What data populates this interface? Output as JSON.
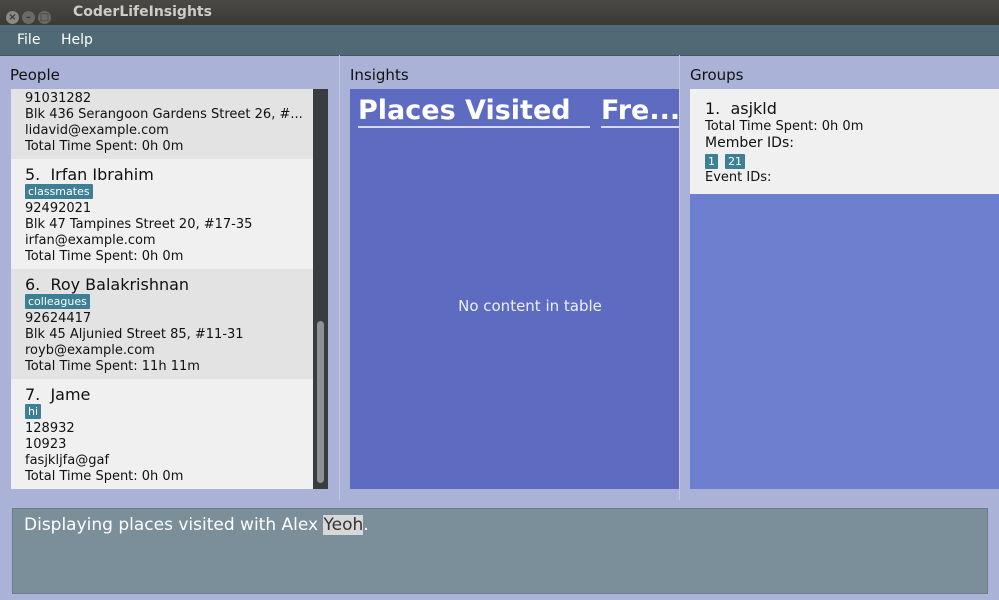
{
  "window": {
    "title": "CoderLifeInsights"
  },
  "menu": {
    "items": [
      "File",
      "Help"
    ]
  },
  "people": {
    "title": "People",
    "persons": [
      {
        "phone": "91031282",
        "address": "Blk 436 Serangoon Gardens Street 26, #...",
        "email": "lidavid@example.com",
        "time": "Total Time Spent: 0h 0m"
      },
      {
        "index": "5.",
        "name": "Irfan Ibrahim",
        "tag": "classmates",
        "phone": "92492021",
        "address": "Blk 47 Tampines Street 20, #17-35",
        "email": "irfan@example.com",
        "time": "Total Time Spent: 0h 0m"
      },
      {
        "index": "6.",
        "name": "Roy Balakrishnan",
        "tag": "colleagues",
        "phone": "92624417",
        "address": "Blk 45 Aljunied Street 85, #11-31",
        "email": "royb@example.com",
        "time": "Total Time Spent: 11h 11m"
      },
      {
        "index": "7.",
        "name": "Jame",
        "tag": "hi",
        "phone": "128932",
        "address": "10923",
        "email": "fasjkljfa@gaf",
        "time": "Total Time Spent: 0h 0m"
      }
    ]
  },
  "insights": {
    "title": "Insights",
    "columns": [
      "Places Visited",
      "Fre..."
    ],
    "empty_text": "No content in table"
  },
  "groups": {
    "title": "Groups",
    "items": [
      {
        "index": "1.",
        "name": "asjkld",
        "time": "Total Time Spent: 0h 0m",
        "member_label": "Member IDs:",
        "member_ids": [
          "1",
          "21"
        ],
        "event_label": "Event IDs:"
      }
    ]
  },
  "result": {
    "text_before": "Displaying places visited with Alex ",
    "highlight": "Yeoh",
    "text_after": "."
  },
  "colors": {
    "tag": "#3d7f94",
    "menubar": "#4f6a75",
    "insights_bg": "#5d6bc0",
    "groups_bg": "#6f7fd0",
    "result_bg": "#7a8f99"
  }
}
